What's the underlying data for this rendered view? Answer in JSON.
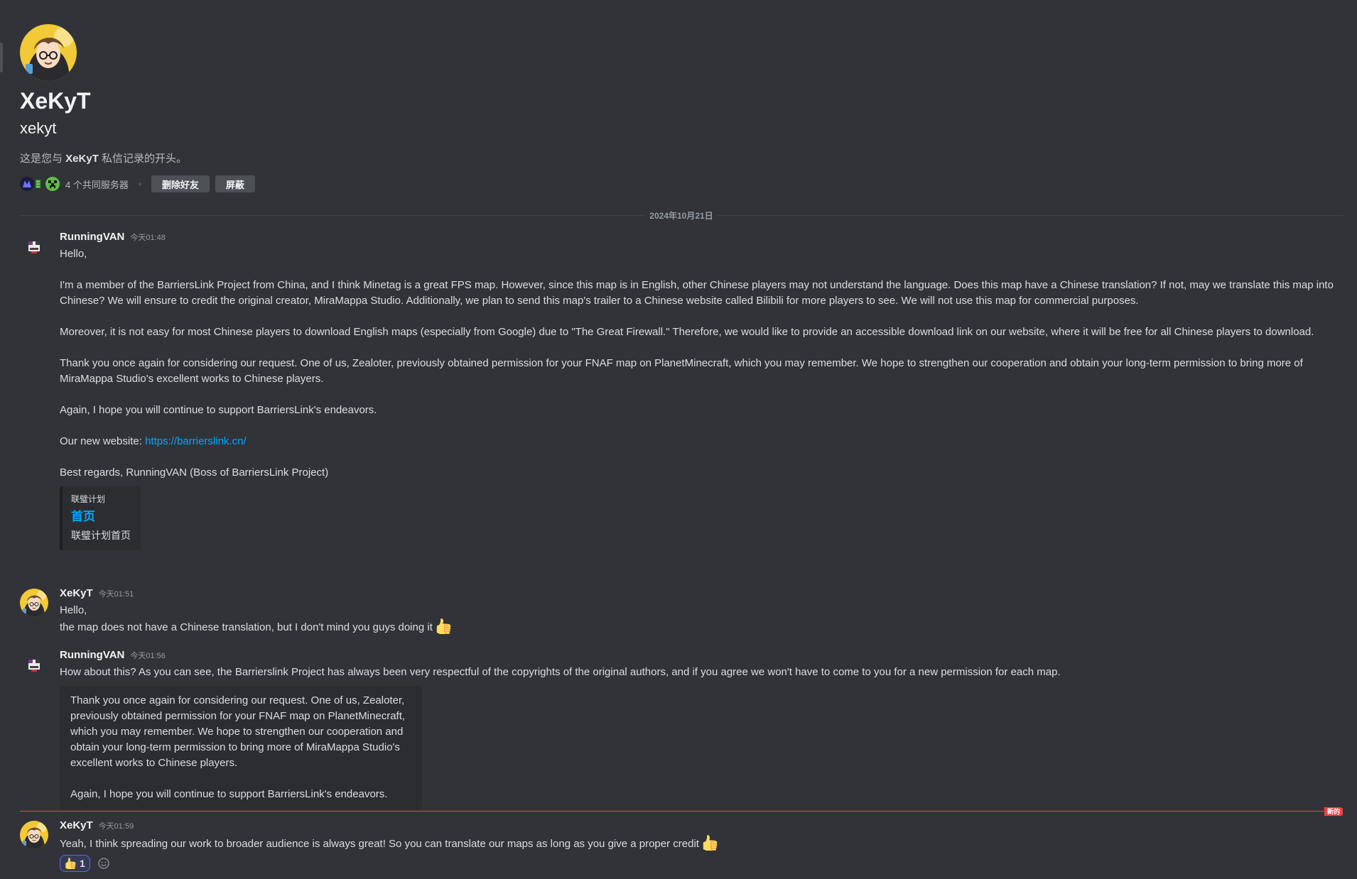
{
  "profile": {
    "display_name": "XeKyT",
    "username": "xekyt",
    "intro_prefix": "这是您与 ",
    "intro_name": "XeKyT",
    "intro_suffix": " 私信记录的开头。",
    "mutual_servers": "4 个共同服务器",
    "remove_friend": "删除好友",
    "block": "屏蔽"
  },
  "date_divider": "2024年10月21日",
  "messages": [
    {
      "author": "RunningVAN",
      "time": "今天01:48",
      "paragraphs": [
        "Hello,",
        "I'm a member of the BarriersLink Project from China, and I think Minetag is a great FPS map. However, since this map is in English, other Chinese players may not understand the language. Does this map have a Chinese translation? If not, may we translate this map into Chinese? We will ensure to credit the original creator, MiraMappa Studio. Additionally, we plan to send this map's trailer to a Chinese website called Bilibili for more players to see. We will not use this map for commercial purposes.",
        "Moreover, it is not easy for most Chinese players to download English maps (especially from Google) due to \"The Great Firewall.\" Therefore, we would like to provide an accessible download link on our website, where it will be free for all Chinese players to download.",
        "Thank you once again for considering our request. One of us, Zealoter, previously obtained permission for your FNAF map on PlanetMinecraft, which you may remember. We hope to strengthen our cooperation and obtain your long-term permission to bring more of MiraMappa Studio's excellent works to Chinese players.",
        "Again, I hope you will continue to support BarriersLink's endeavors."
      ],
      "website_prefix": "Our new website: ",
      "website_link": "https://barrierslink.cn/",
      "signature": "Best regards, RunningVAN (Boss of BarriersLink Project)",
      "embed": {
        "provider": "联璧计划",
        "title": "首页",
        "description": "联璧计划首页"
      }
    },
    {
      "author": "XeKyT",
      "time": "今天01:51",
      "line1": "Hello,",
      "line2": "the map does not have a Chinese translation, but I don't mind you guys doing it",
      "emoji": "thumbs-up"
    },
    {
      "author": "RunningVAN",
      "time": "今天01:56",
      "text": "How about this? As you can see, the Barrierslink Project has always been very respectful of the copyrights of the original authors, and if you agree  we won't have to come to you for a new permission for each map.",
      "quote": [
        "Thank you once again for considering our request. One of us, Zealoter, previously obtained permission for your FNAF map on PlanetMinecraft, which you may remember. We hope to strengthen our cooperation and obtain your long-term permission to bring more of MiraMappa Studio's excellent works to Chinese players.",
        "Again, I hope you will continue to support BarriersLink's endeavors."
      ]
    },
    {
      "author": "XeKyT",
      "time": "今天01:59",
      "text": "Yeah, I think spreading our work to broader audience is always great! So you can translate our maps as long as you give a proper credit",
      "emoji": "thumbs-up",
      "reaction": {
        "emoji": "thumbs-up",
        "count": "1"
      }
    }
  ],
  "new_badge": "新的",
  "colors": {
    "background": "#323339",
    "link": "#00a8fc",
    "new_line": "#f23f43",
    "reaction_border": "#5865f2"
  }
}
